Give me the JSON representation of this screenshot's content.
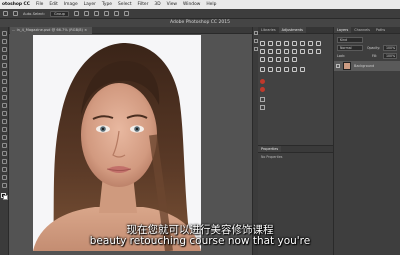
{
  "menubar": {
    "app_name": "otoshop CC",
    "items": [
      "File",
      "Edit",
      "Image",
      "Layer",
      "Type",
      "Select",
      "Filter",
      "3D",
      "View",
      "Window",
      "Help"
    ]
  },
  "options_bar": {
    "label_1": "Auto-Select:",
    "value_1": "Group"
  },
  "window": {
    "title": "Adobe Photoshop CC 2015"
  },
  "document_tab": {
    "label": "... in_4_Magazine.psd @ 66.7% (RGB/8) ×"
  },
  "adjustments_panel": {
    "tabs": [
      "Libraries",
      "Adjustments"
    ]
  },
  "properties_panel": {
    "title": "Properties",
    "subtitle": "No Properties"
  },
  "layers_panel": {
    "tabs": [
      "Layers",
      "Channels",
      "Paths"
    ],
    "kind_label": "Kind",
    "blend_mode": "Normal",
    "opacity_label": "Opacity:",
    "opacity_value": "100%",
    "lock_label": "Lock:",
    "fill_label": "Fill:",
    "fill_value": "100%",
    "layer_name": "Background"
  },
  "subtitles": {
    "chinese": "现在您就可以进行美容修饰课程",
    "english": "beauty retouching course now that you're"
  },
  "colors": {
    "ui_dark": "#535353",
    "panel": "#3e3e3e",
    "accent_red": "#c0392b"
  }
}
